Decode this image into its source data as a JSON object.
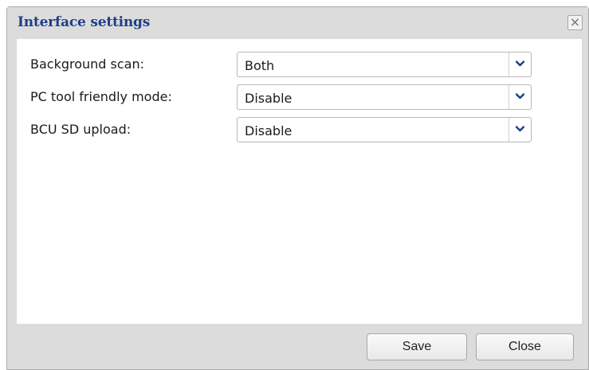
{
  "dialog": {
    "title": "Interface settings",
    "close_icon": "close-icon",
    "accent_color": "#1e3f88"
  },
  "settings": [
    {
      "label": "Background scan:",
      "value": "Both"
    },
    {
      "label": "PC tool friendly mode:",
      "value": "Disable"
    },
    {
      "label": "BCU SD upload:",
      "value": "Disable"
    }
  ],
  "footer": {
    "save_label": "Save",
    "close_label": "Close"
  }
}
